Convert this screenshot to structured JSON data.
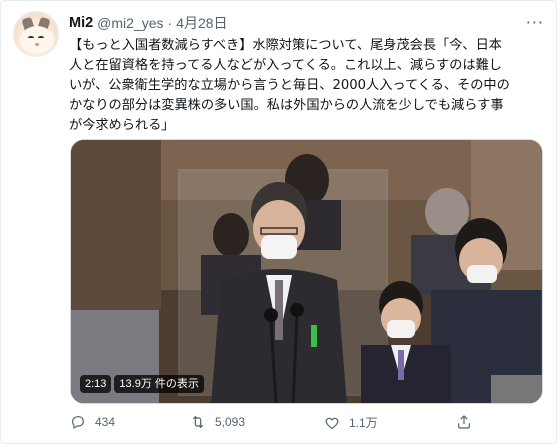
{
  "author": {
    "name": "Mi2",
    "handle": "@mi2_yes",
    "separator": "·",
    "date": "4月28日"
  },
  "tweet": {
    "text": "【もっと入国者数減らすべき】水際対策について、尾身茂会長「今、日本\n人と在留資格を持ってる人などが入ってくる。これ以上、減らすのは難し\nいが、公衆衛生学的な立場から言うと毎日、2000人入ってくる、その中の\nかなりの部分は変異株の多い国。私は外国からの人流を少しでも減らす事\nが今求められる」"
  },
  "video": {
    "duration": "2:13",
    "views": "13.9万 件の表示"
  },
  "actions": {
    "reply_count": "434",
    "retweet_count": "5,093",
    "like_count": "1.1万"
  },
  "icons": {
    "more": "more-icon",
    "reply": "reply-icon",
    "retweet": "retweet-icon",
    "like": "like-icon",
    "share": "share-icon"
  },
  "colors": {
    "secondary_text": "#536471",
    "border": "#cfd9de"
  }
}
